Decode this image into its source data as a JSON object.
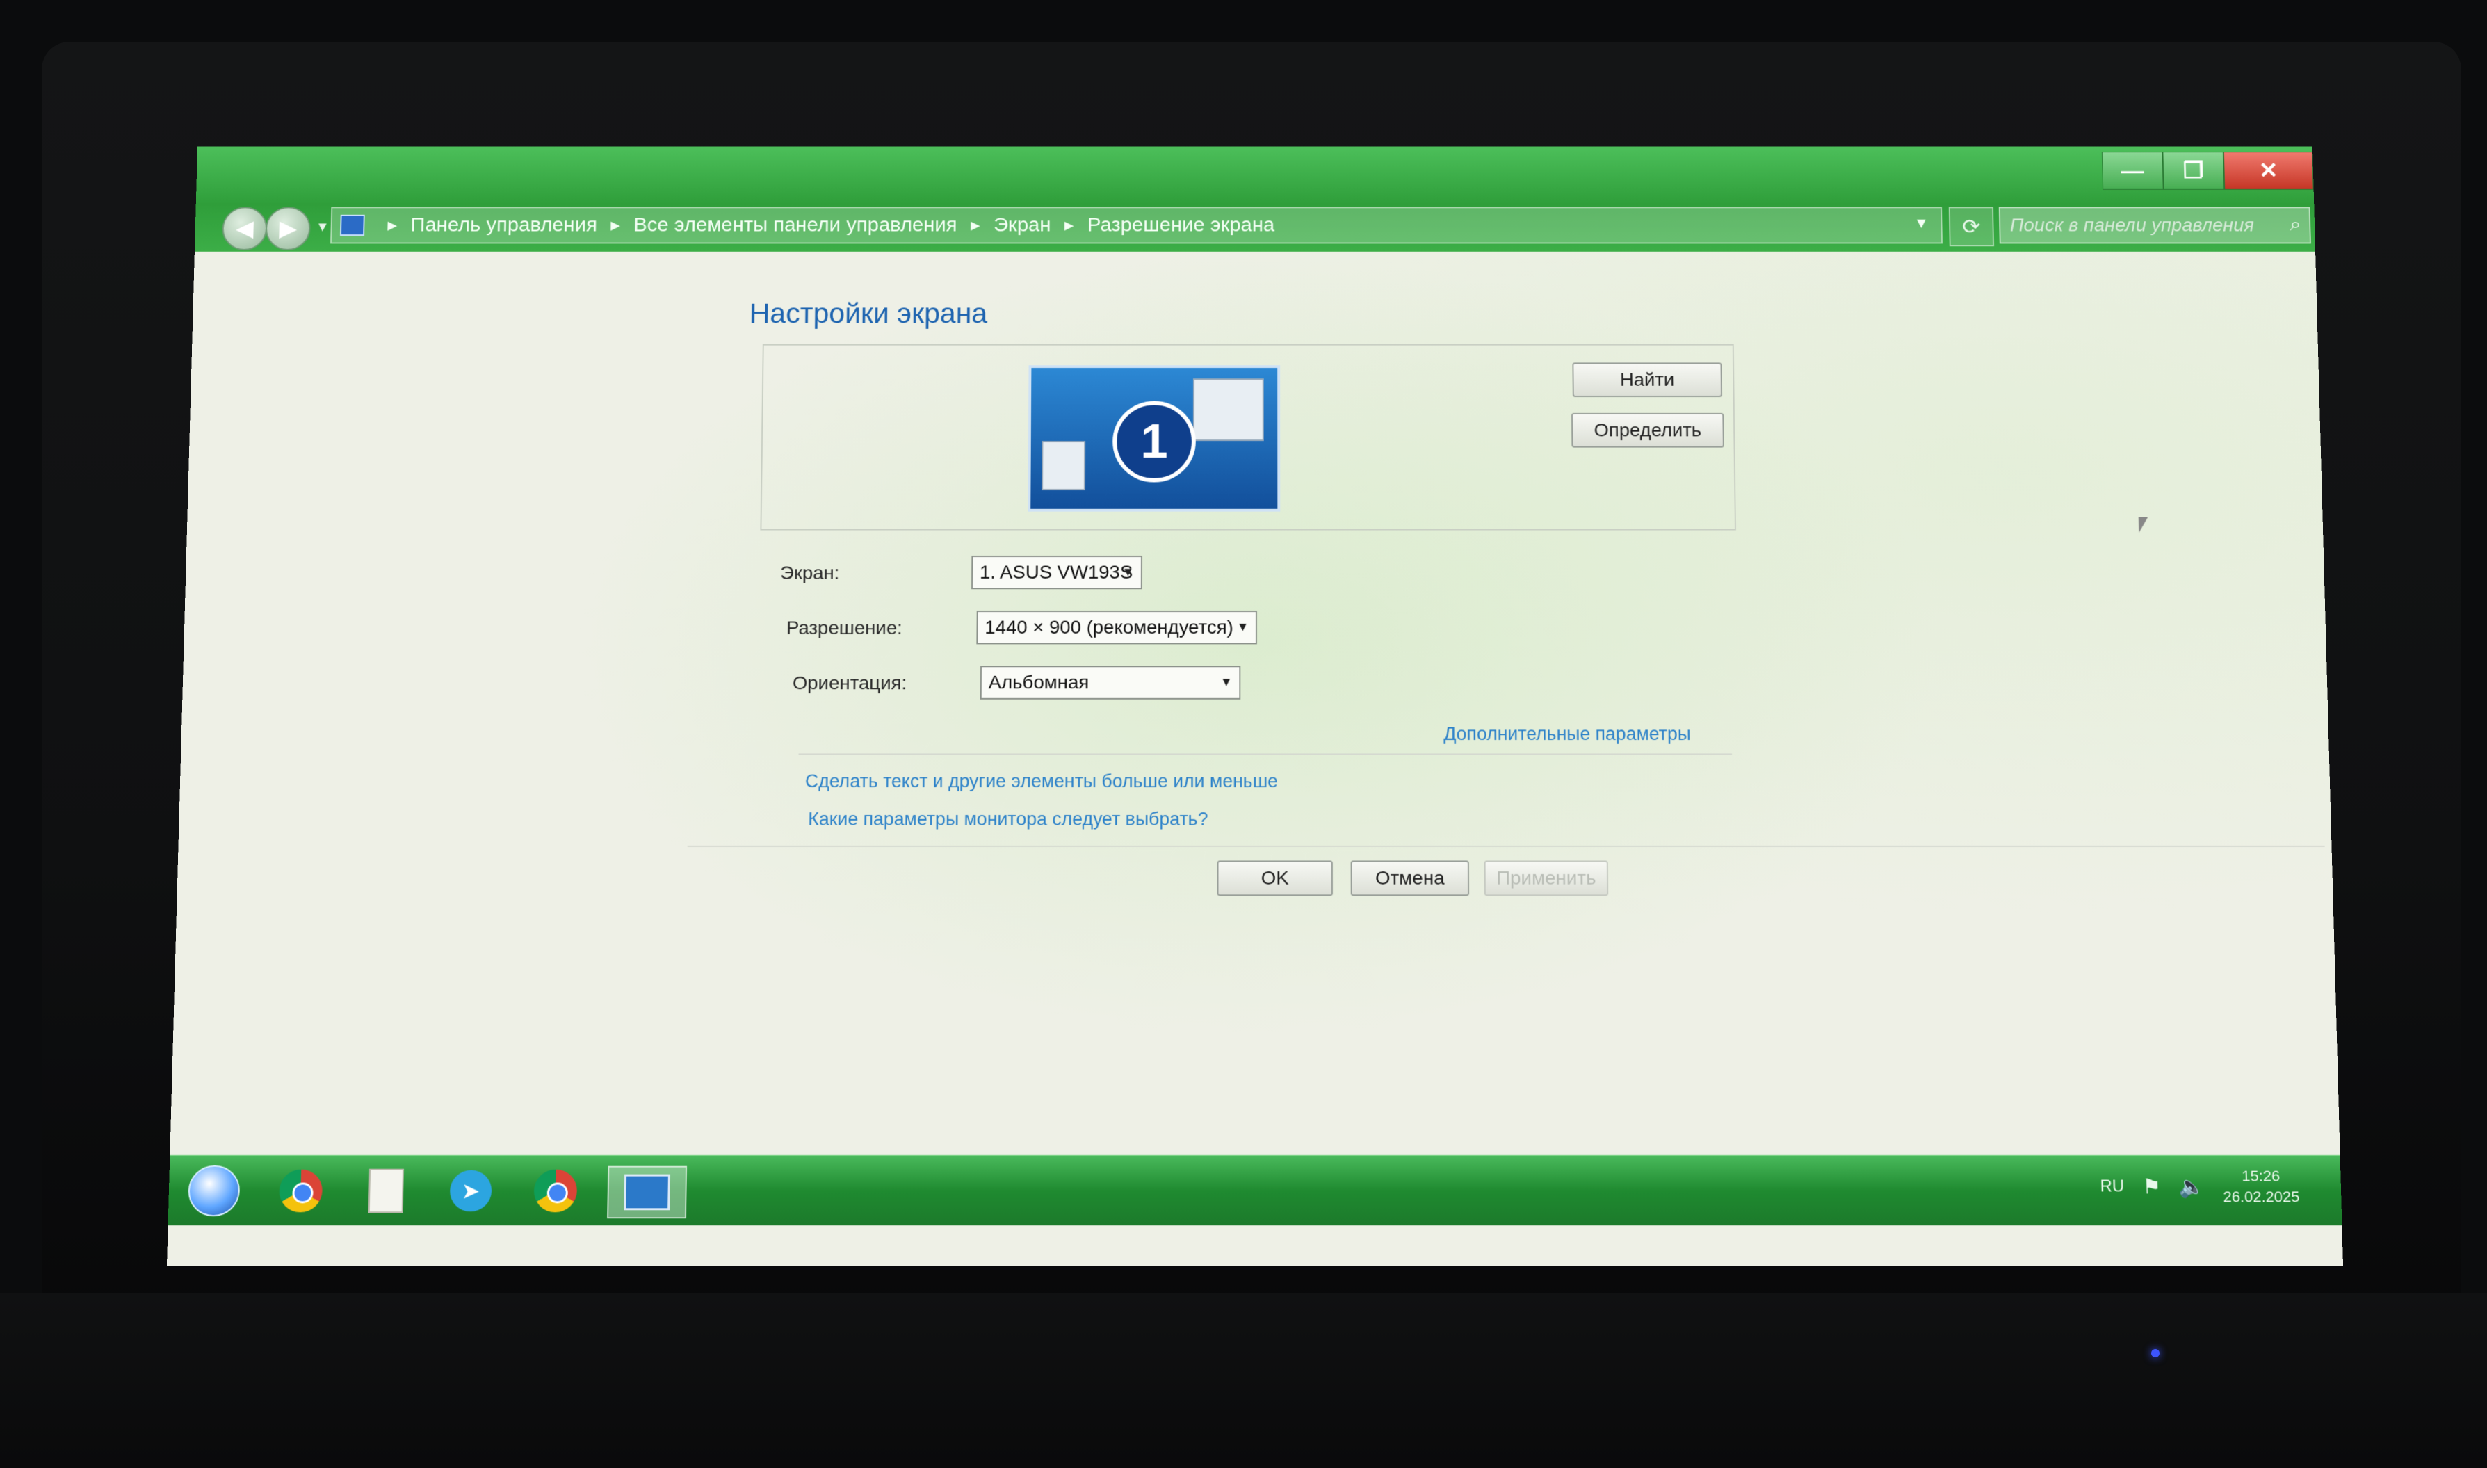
{
  "window": {
    "controls": {
      "minimize": "—",
      "maximize": "❐",
      "close": "✕"
    }
  },
  "address_bar": {
    "crumbs": [
      "Панель управления",
      "Все элементы панели управления",
      "Экран",
      "Разрешение экрана"
    ],
    "search_placeholder": "Поиск в панели управления"
  },
  "main": {
    "heading": "Настройки экрана",
    "monitor_number": "1",
    "detect_button": "Найти",
    "identify_button": "Определить",
    "fields": {
      "display_label": "Экран:",
      "display_value": "1. ASUS VW193S",
      "resolution_label": "Разрешение:",
      "resolution_value": "1440 × 900 (рекомендуется)",
      "orientation_label": "Ориентация:",
      "orientation_value": "Альбомная"
    },
    "advanced_link": "Дополнительные параметры",
    "links": [
      "Сделать текст и другие элементы больше или меньше",
      "Какие параметры монитора следует выбрать?"
    ],
    "ok_button": "OK",
    "cancel_button": "Отмена",
    "apply_button": "Применить"
  },
  "taskbar": {
    "language": "RU",
    "time": "15:26",
    "date": "26.02.2025"
  },
  "colors": {
    "titlebar": "#2f9e3a",
    "link": "#2d82c9",
    "heading": "#1e64b0"
  }
}
